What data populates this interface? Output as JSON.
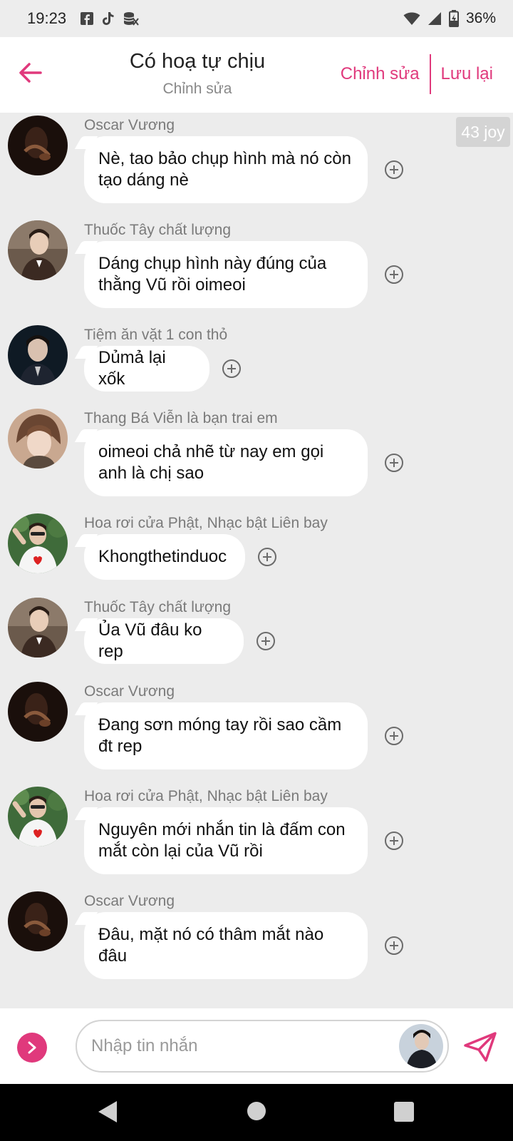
{
  "status_bar": {
    "time": "19:23",
    "battery": "36%",
    "apps": [
      "facebook-icon",
      "tiktok-icon",
      "data-icon"
    ]
  },
  "header": {
    "title": "Có hoạ tự chịu",
    "subtitle": "Chỉnh sửa",
    "edit_label": "Chỉnh sửa",
    "save_label": "Lưu lại"
  },
  "joy_badge": "43 joy",
  "messages": [
    {
      "sender": "Oscar Vương",
      "text": "Nè, tao bảo chụp hình mà nó còn tạo dáng nè"
    },
    {
      "sender": "Thuốc Tây chất lượng",
      "text": "Dáng chụp hình này đúng của thằng Vũ rồi oimeoi"
    },
    {
      "sender": "Tiệm ăn vặt 1 con thỏ",
      "text": "Dủmả lại xốk"
    },
    {
      "sender": "Thang Bá Viễn là bạn trai em",
      "text": "oimeoi chả nhẽ từ nay em gọi anh là chị sao"
    },
    {
      "sender": "Hoa rơi cửa Phật, Nhạc bật Liên bay",
      "text": "Khongthetinduoc"
    },
    {
      "sender": "Thuốc Tây chất lượng",
      "text": "Ủa Vũ đâu ko rep"
    },
    {
      "sender": "Oscar Vương",
      "text": "Đang sơn móng tay rồi sao cầm đt rep"
    },
    {
      "sender": "Hoa rơi cửa Phật, Nhạc bật Liên bay",
      "text": "Nguyên mới nhắn tin là đấm con mắt còn lại của Vũ rồi"
    },
    {
      "sender": "Oscar Vương",
      "text": "Đâu, mặt nó có thâm mắt nào đâu"
    }
  ],
  "composer": {
    "placeholder": "Nhập tin nhắn"
  },
  "colors": {
    "accent": "#e0397c",
    "background": "#ececec",
    "bubble": "#ffffff"
  }
}
